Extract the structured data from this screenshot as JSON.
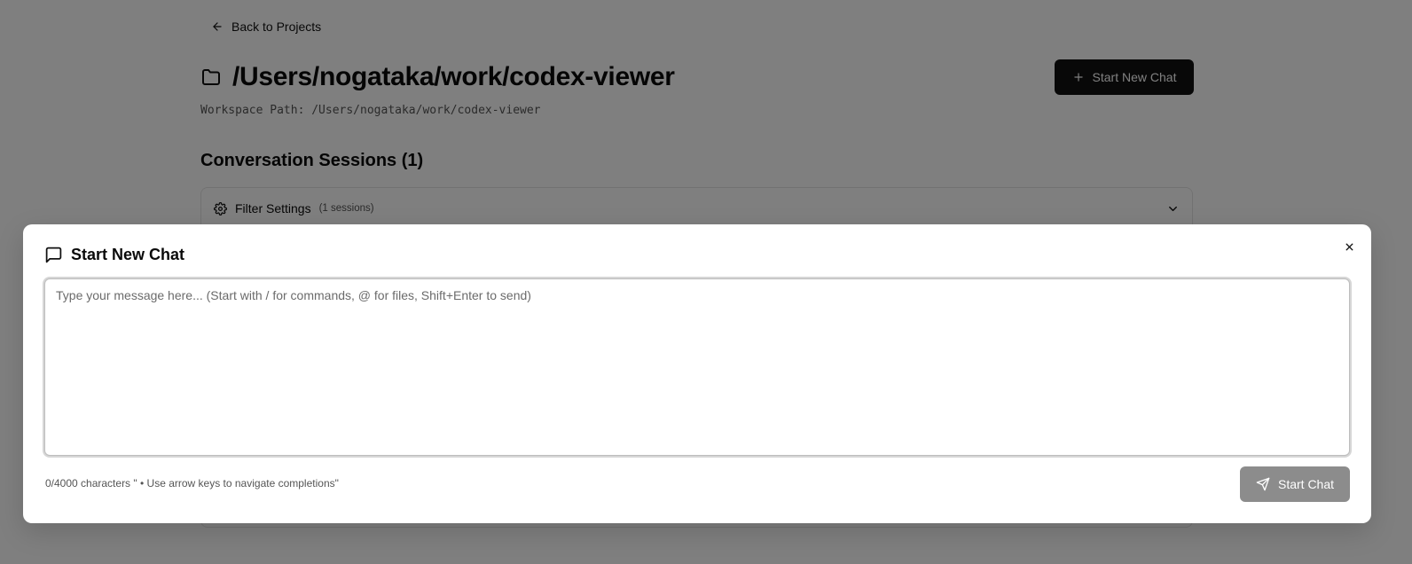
{
  "header": {
    "back_label": "Back to Projects",
    "title": "/Users/nogataka/work/codex-viewer",
    "workspace_path": "Workspace Path: /Users/nogataka/work/codex-viewer",
    "new_chat_label": "Start New Chat"
  },
  "sessions": {
    "heading": "Conversation Sessions (1)",
    "filter_label": "Filter Settings",
    "filter_count": "(1 sessions)"
  },
  "modal": {
    "title": "Start New Chat",
    "input_placeholder": "Type your message here... (Start with / for commands, @ for files, Shift+Enter to send)",
    "input_value": "",
    "char_count": "0/4000 characters \" • Use arrow keys to navigate completions\"",
    "submit_label": "Start Chat",
    "submit_disabled": true
  },
  "icons": {
    "back": "arrow-left-icon",
    "folder": "folder-icon",
    "plus": "plus-icon",
    "gear": "gear-icon",
    "chevron": "chevron-down-icon",
    "chat": "message-square-icon",
    "close": "close-icon",
    "send": "send-icon"
  }
}
